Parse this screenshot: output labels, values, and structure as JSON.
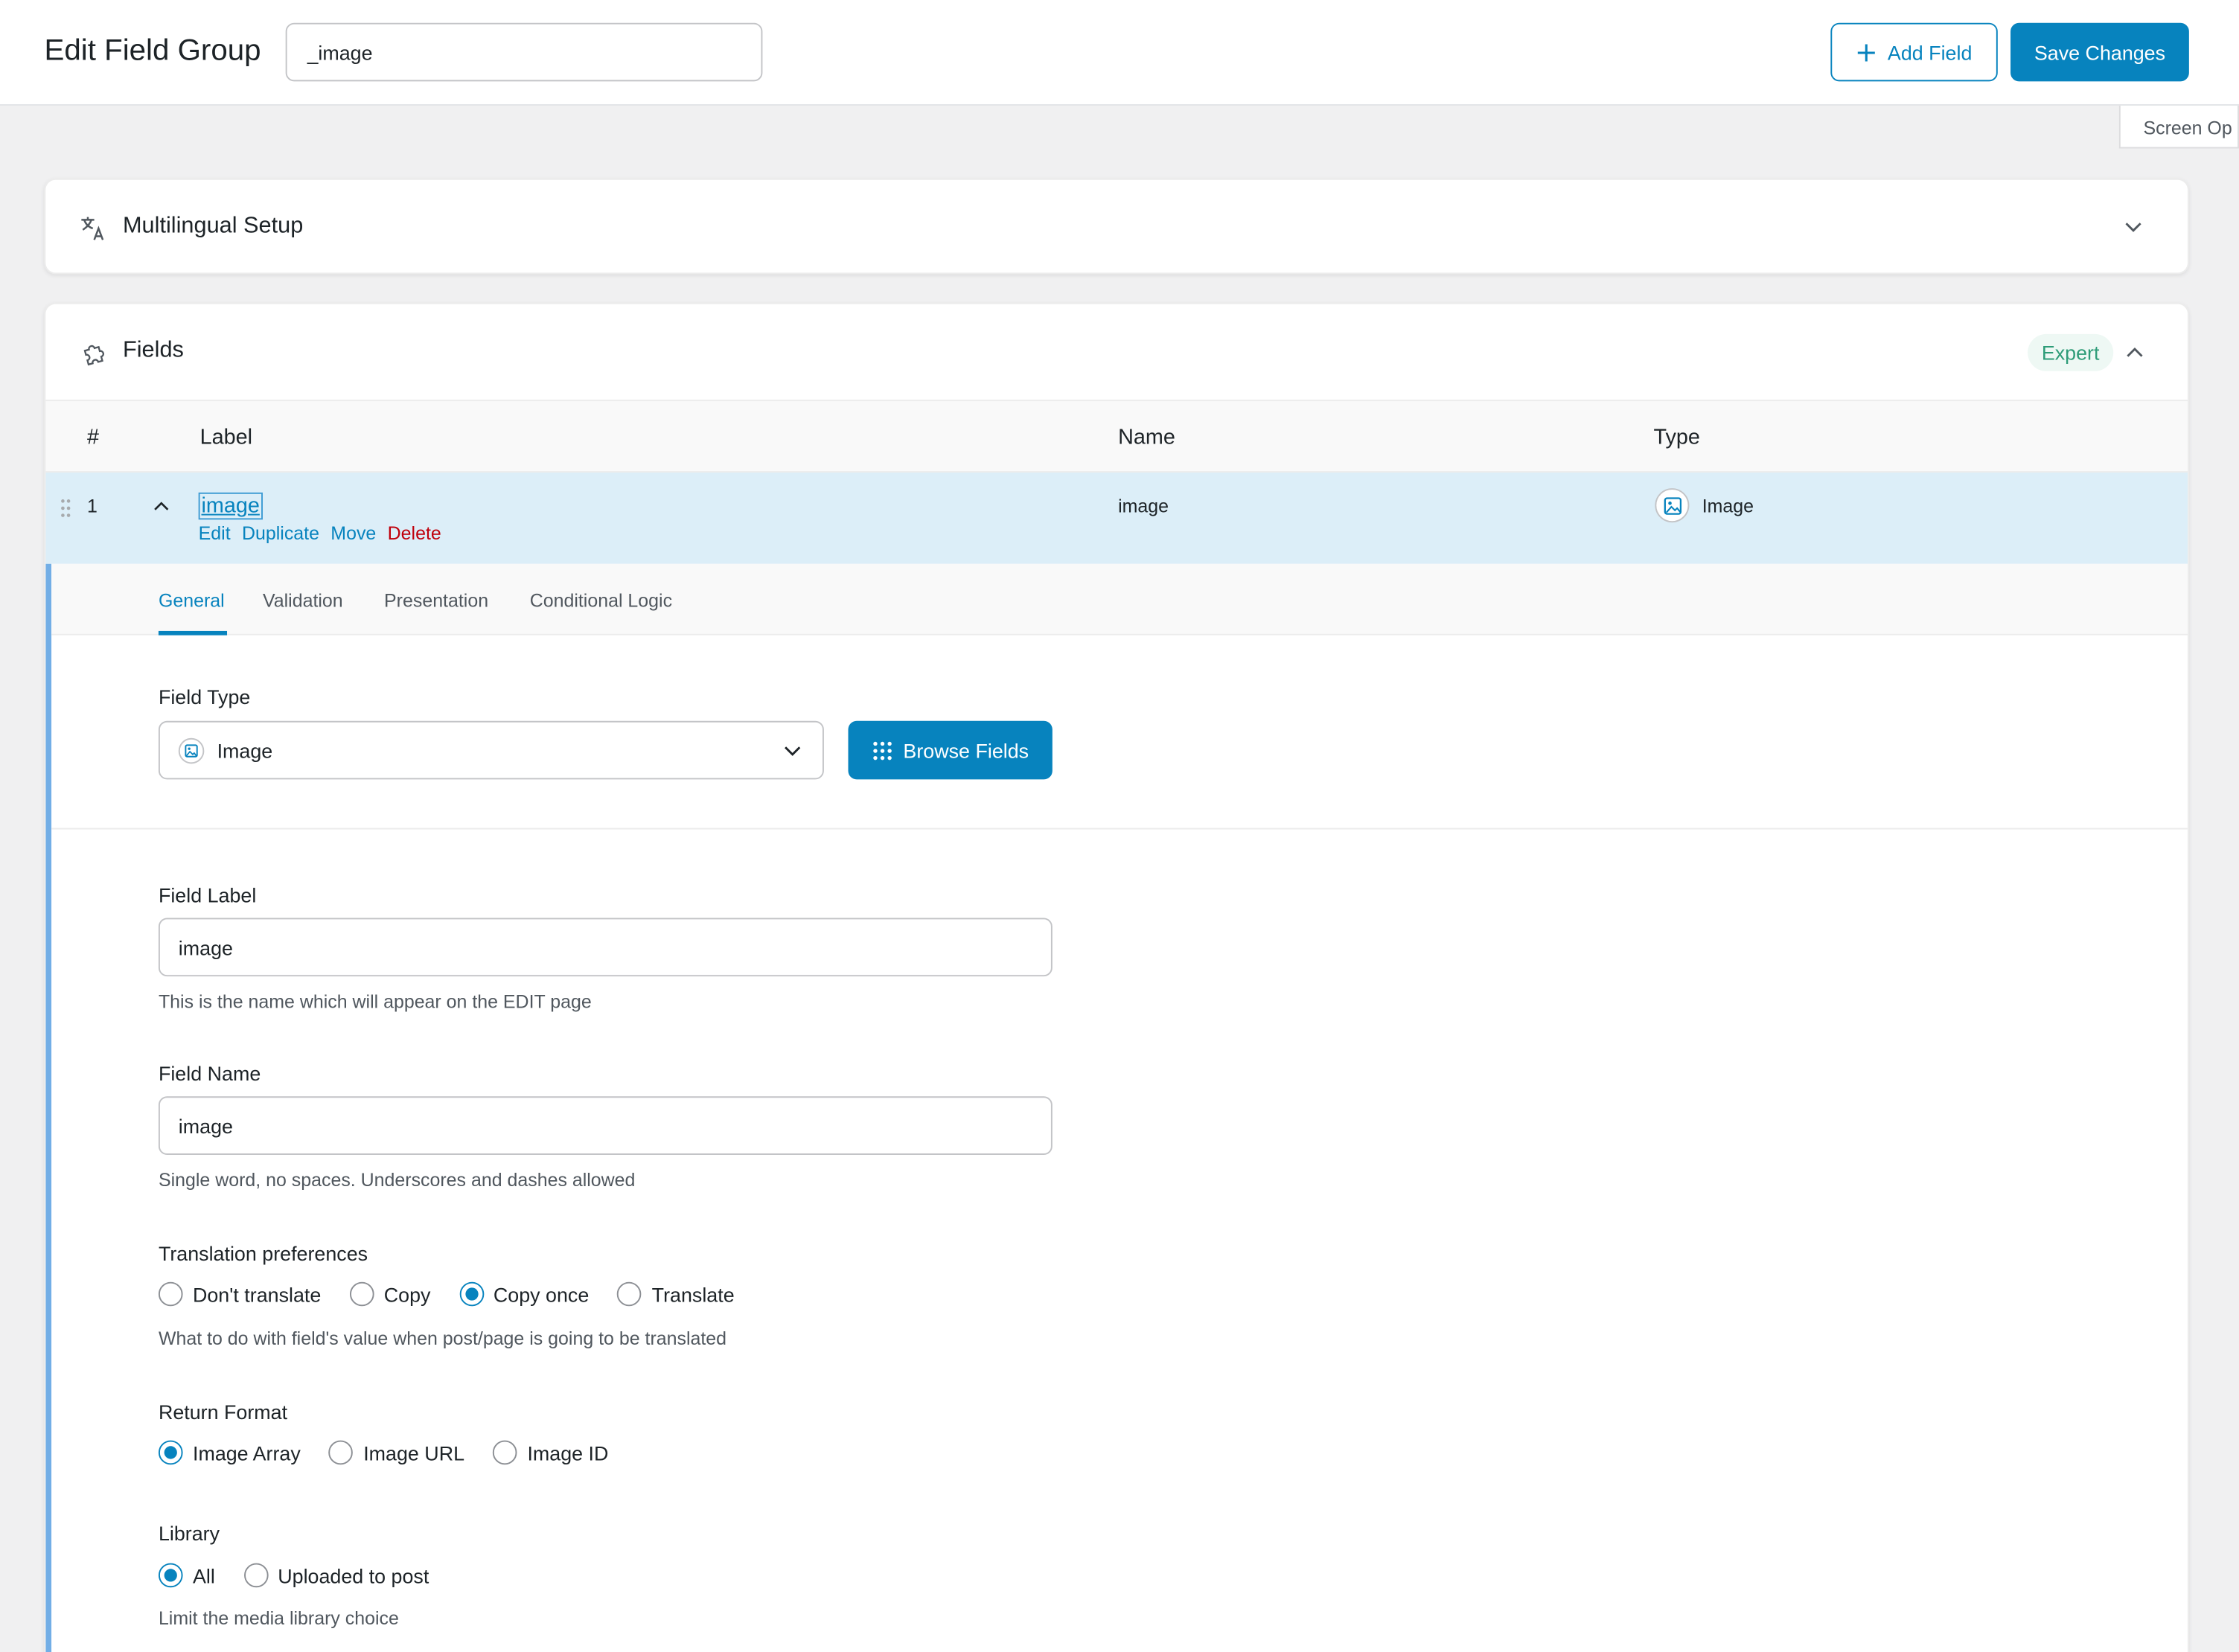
{
  "header": {
    "title": "Edit Field Group",
    "title_input_value": "_image",
    "add_field_label": "Add Field",
    "save_label": "Save Changes",
    "screen_options_label": "Screen Op"
  },
  "multilingual": {
    "title": "Multilingual Setup"
  },
  "fields_panel": {
    "title": "Fields",
    "badge": "Expert",
    "columns": [
      "#",
      "Label",
      "Name",
      "Type"
    ],
    "rows": [
      {
        "number": "1",
        "label": "image",
        "name": "image",
        "type": "Image",
        "actions": [
          "Edit",
          "Duplicate",
          "Move",
          "Delete"
        ]
      }
    ]
  },
  "settings": {
    "tabs": [
      "General",
      "Validation",
      "Presentation",
      "Conditional Logic"
    ],
    "active_tab": "General",
    "field_type": {
      "label": "Field Type",
      "value": "Image",
      "browse_label": "Browse Fields"
    },
    "field_label": {
      "label": "Field Label",
      "value": "image",
      "help": "This is the name which will appear on the EDIT page"
    },
    "field_name": {
      "label": "Field Name",
      "value": "image",
      "help": "Single word, no spaces. Underscores and dashes allowed"
    },
    "translation": {
      "label": "Translation preferences",
      "options": [
        "Don't translate",
        "Copy",
        "Copy once",
        "Translate"
      ],
      "selected": "Copy once",
      "help": "What to do with field's value when post/page is going to be translated"
    },
    "return_format": {
      "label": "Return Format",
      "options": [
        "Image Array",
        "Image URL",
        "Image ID"
      ],
      "selected": "Image Array"
    },
    "library": {
      "label": "Library",
      "options": [
        "All",
        "Uploaded to post"
      ],
      "selected": "All",
      "help": "Limit the media library choice"
    }
  },
  "icons": {
    "translate": "translate-icon",
    "puzzle": "puzzle-icon",
    "plus": "plus-icon",
    "grid": "grid-icon",
    "image": "image-icon",
    "chevron_down": "chevron-down-icon",
    "chevron_up": "chevron-up-icon",
    "drag": "drag-handle-icon"
  },
  "colors": {
    "accent": "#0783be",
    "delete": "#c0000b",
    "expert_text": "#2e9c78",
    "row_selected": "#dceef8",
    "settings_border": "#72aee6"
  }
}
